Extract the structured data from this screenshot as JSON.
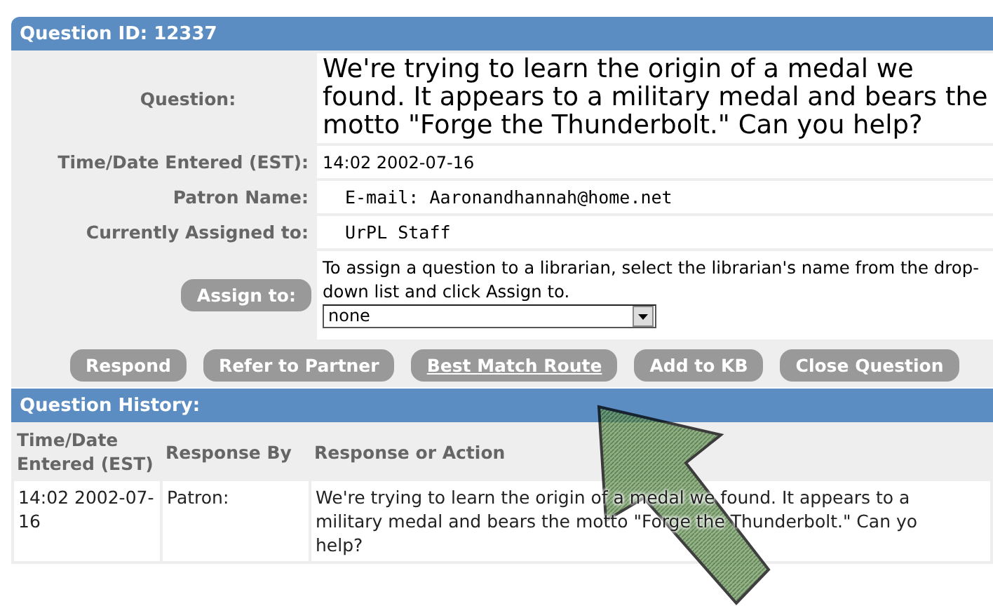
{
  "header": {
    "title": "Question ID: 12337"
  },
  "fields": [
    {
      "kind": "question",
      "label": "Question:",
      "value": "We're trying to learn the origin of a medal we found. It appears to a military medal and bears the motto \"Forge the Thunderbolt.\" Can you help?"
    },
    {
      "kind": "plain",
      "label": "Time/Date Entered (EST):",
      "value": "14:02 2002-07-16"
    },
    {
      "kind": "mono",
      "label": "Patron Name:",
      "value": "E-mail:  Aaronandhannah@home.net"
    },
    {
      "kind": "mono",
      "label": "Currently Assigned to:",
      "value": "UrPL Staff"
    }
  ],
  "assign": {
    "button": "Assign to:",
    "instructions": "To assign a question to a librarian, select the librarian's name from the drop-down list and click Assign to.",
    "select_value": "none"
  },
  "actions": [
    {
      "label": "Respond",
      "underlined": false
    },
    {
      "label": "Refer to Partner",
      "underlined": false
    },
    {
      "label": "Best Match Route",
      "underlined": true
    },
    {
      "label": "Add to KB",
      "underlined": false
    },
    {
      "label": "Close Question",
      "underlined": false
    }
  ],
  "history": {
    "title": "Question History:",
    "columns": [
      "Time/Date Entered (EST)",
      "Response By",
      "Response or Action"
    ],
    "rows": [
      [
        "14:02 2002-07-16",
        "Patron:",
        "We're trying to learn the origin of a medal we found. It appears to a\nmilitary medal and bears the motto \"Forge the Thunderbolt.\" Can yo\nhelp?"
      ]
    ]
  }
}
